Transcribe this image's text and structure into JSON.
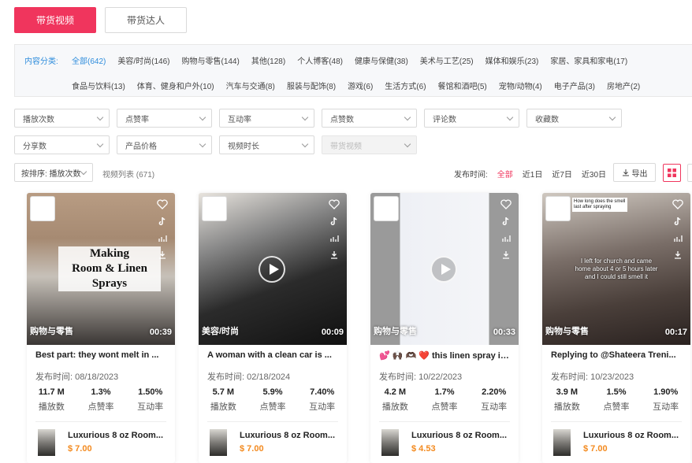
{
  "top_tabs": {
    "video": "带货视频",
    "creator": "带货达人"
  },
  "category": {
    "label": "内容分类:",
    "row1": [
      "全部(642)",
      "美容/时尚(146)",
      "购物与零售(144)",
      "其他(128)",
      "个人博客(48)",
      "健康与保健(38)",
      "美术与工艺(25)",
      "媒体和娱乐(23)",
      "家居、家具和家电(17)"
    ],
    "row2": [
      "食品与饮料(13)",
      "体育、健身和户外(10)",
      "汽车与交通(8)",
      "服装与配饰(8)",
      "游戏(6)",
      "生活方式(6)",
      "餐馆和酒吧(5)",
      "宠物/动物(4)",
      "电子产品(3)",
      "房地产(2)"
    ]
  },
  "filters": {
    "row1": [
      "播放次数",
      "点赞率",
      "互动率",
      "点赞数",
      "评论数",
      "收藏数"
    ],
    "row2": [
      "分享数",
      "产品价格",
      "视频时长",
      "带货视频"
    ]
  },
  "sortbar": {
    "sort": "按排序: 播放次数",
    "list_count": "视频列表 (671)",
    "time_label": "发布时间:",
    "time_options": [
      "全部",
      "近1日",
      "近7日",
      "近30日"
    ],
    "export": "导出"
  },
  "cards": [
    {
      "tag": "购物与零售",
      "duration": "00:39",
      "title": "Best part: they wont melt in ...",
      "date": "发布时间:  08/18/2023",
      "plays": "11.7 M",
      "like_rate": "1.3%",
      "engage_rate": "1.50%",
      "overlay": [
        "Making",
        "Room & Linen",
        "Sprays"
      ],
      "product": "Luxurious 8 oz Room...",
      "price": "$ 7.00"
    },
    {
      "tag": "美容/时尚",
      "duration": "00:09",
      "title": "A woman with a clean car is ...",
      "date": "发布时间:  02/18/2024",
      "plays": "5.7 M",
      "like_rate": "5.9%",
      "engage_rate": "7.40%",
      "product": "Luxurious 8 oz Room...",
      "price": "$ 7.00"
    },
    {
      "tag": "购物与零售",
      "duration": "00:33",
      "title": "💕 🙌🏿 🫶🏿 ❤️  this linen spray is...",
      "date": "发布时间:  10/22/2023",
      "plays": "4.2 M",
      "like_rate": "1.7%",
      "engage_rate": "2.20%",
      "product": "Luxurious 8 oz Room...",
      "price": "$ 4.53"
    },
    {
      "tag": "购物与零售",
      "duration": "00:17",
      "title": "Replying to @Shateera Treni...",
      "date": "发布时间:  10/23/2023",
      "plays": "3.9 M",
      "like_rate": "1.5%",
      "engage_rate": "1.90%",
      "caption_top": "How long does the smell last after spraying",
      "caption_mid": "I left for church and came home about 4 or 5 hours later and I could still smell it",
      "product": "Luxurious 8 oz Room...",
      "price": "$ 7.00"
    }
  ],
  "stat_labels": {
    "plays": "播放数",
    "like_rate": "点赞率",
    "engage_rate": "互动率"
  },
  "colors": {
    "accent": "#f0355d",
    "link": "#2f8ddc",
    "price": "#f38a1f"
  }
}
